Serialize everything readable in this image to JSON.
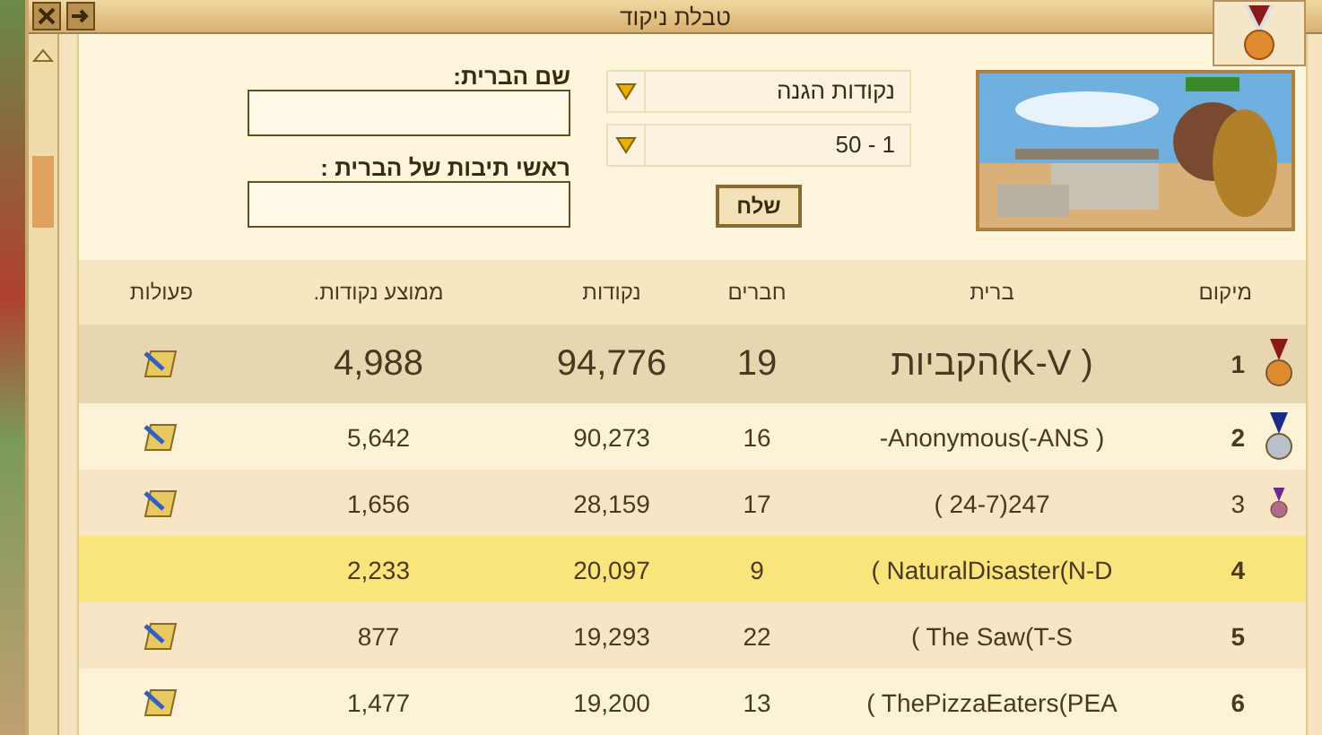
{
  "window": {
    "title": "טבלת ניקוד"
  },
  "filters": {
    "category": "נקודות הגנה",
    "range": "1 - 50",
    "submit": "שלח"
  },
  "search": {
    "name_label": "שם הברית:",
    "tag_label": "ראשי תיבות של הברית :"
  },
  "table": {
    "columns": [
      "מיקום",
      "ברית",
      "חברים",
      "נקודות",
      "ממוצע נקודות.",
      "פעולות"
    ],
    "rows": [
      {
        "kind": "gold",
        "rank": "1",
        "name": "הקביות(K-V )",
        "members": "19",
        "points": "94,776",
        "average": "4,988",
        "has_action": true,
        "selected": false,
        "featured": true
      },
      {
        "kind": "silver",
        "rank": "2",
        "name": "-Anonymous(-ANS )",
        "members": "16",
        "points": "90,273",
        "average": "5,642",
        "has_action": true,
        "selected": false,
        "featured": false
      },
      {
        "kind": "bronze",
        "rank": "3",
        "name": "( 24-7)247",
        "members": "17",
        "points": "28,159",
        "average": "1,656",
        "has_action": true,
        "selected": false,
        "featured": false
      },
      {
        "kind": "plain",
        "rank": "4",
        "name": "( NaturalDisaster(N-D",
        "members": "9",
        "points": "20,097",
        "average": "2,233",
        "has_action": false,
        "selected": true,
        "featured": false
      },
      {
        "kind": "plain",
        "rank": "5",
        "name": "( The Saw(T-S",
        "members": "22",
        "points": "19,293",
        "average": "877",
        "has_action": true,
        "selected": false,
        "featured": false
      },
      {
        "kind": "plain",
        "rank": "6",
        "name": "( ThePizzaEaters(PEA",
        "members": "13",
        "points": "19,200",
        "average": "1,477",
        "has_action": true,
        "selected": false,
        "featured": false
      }
    ]
  }
}
